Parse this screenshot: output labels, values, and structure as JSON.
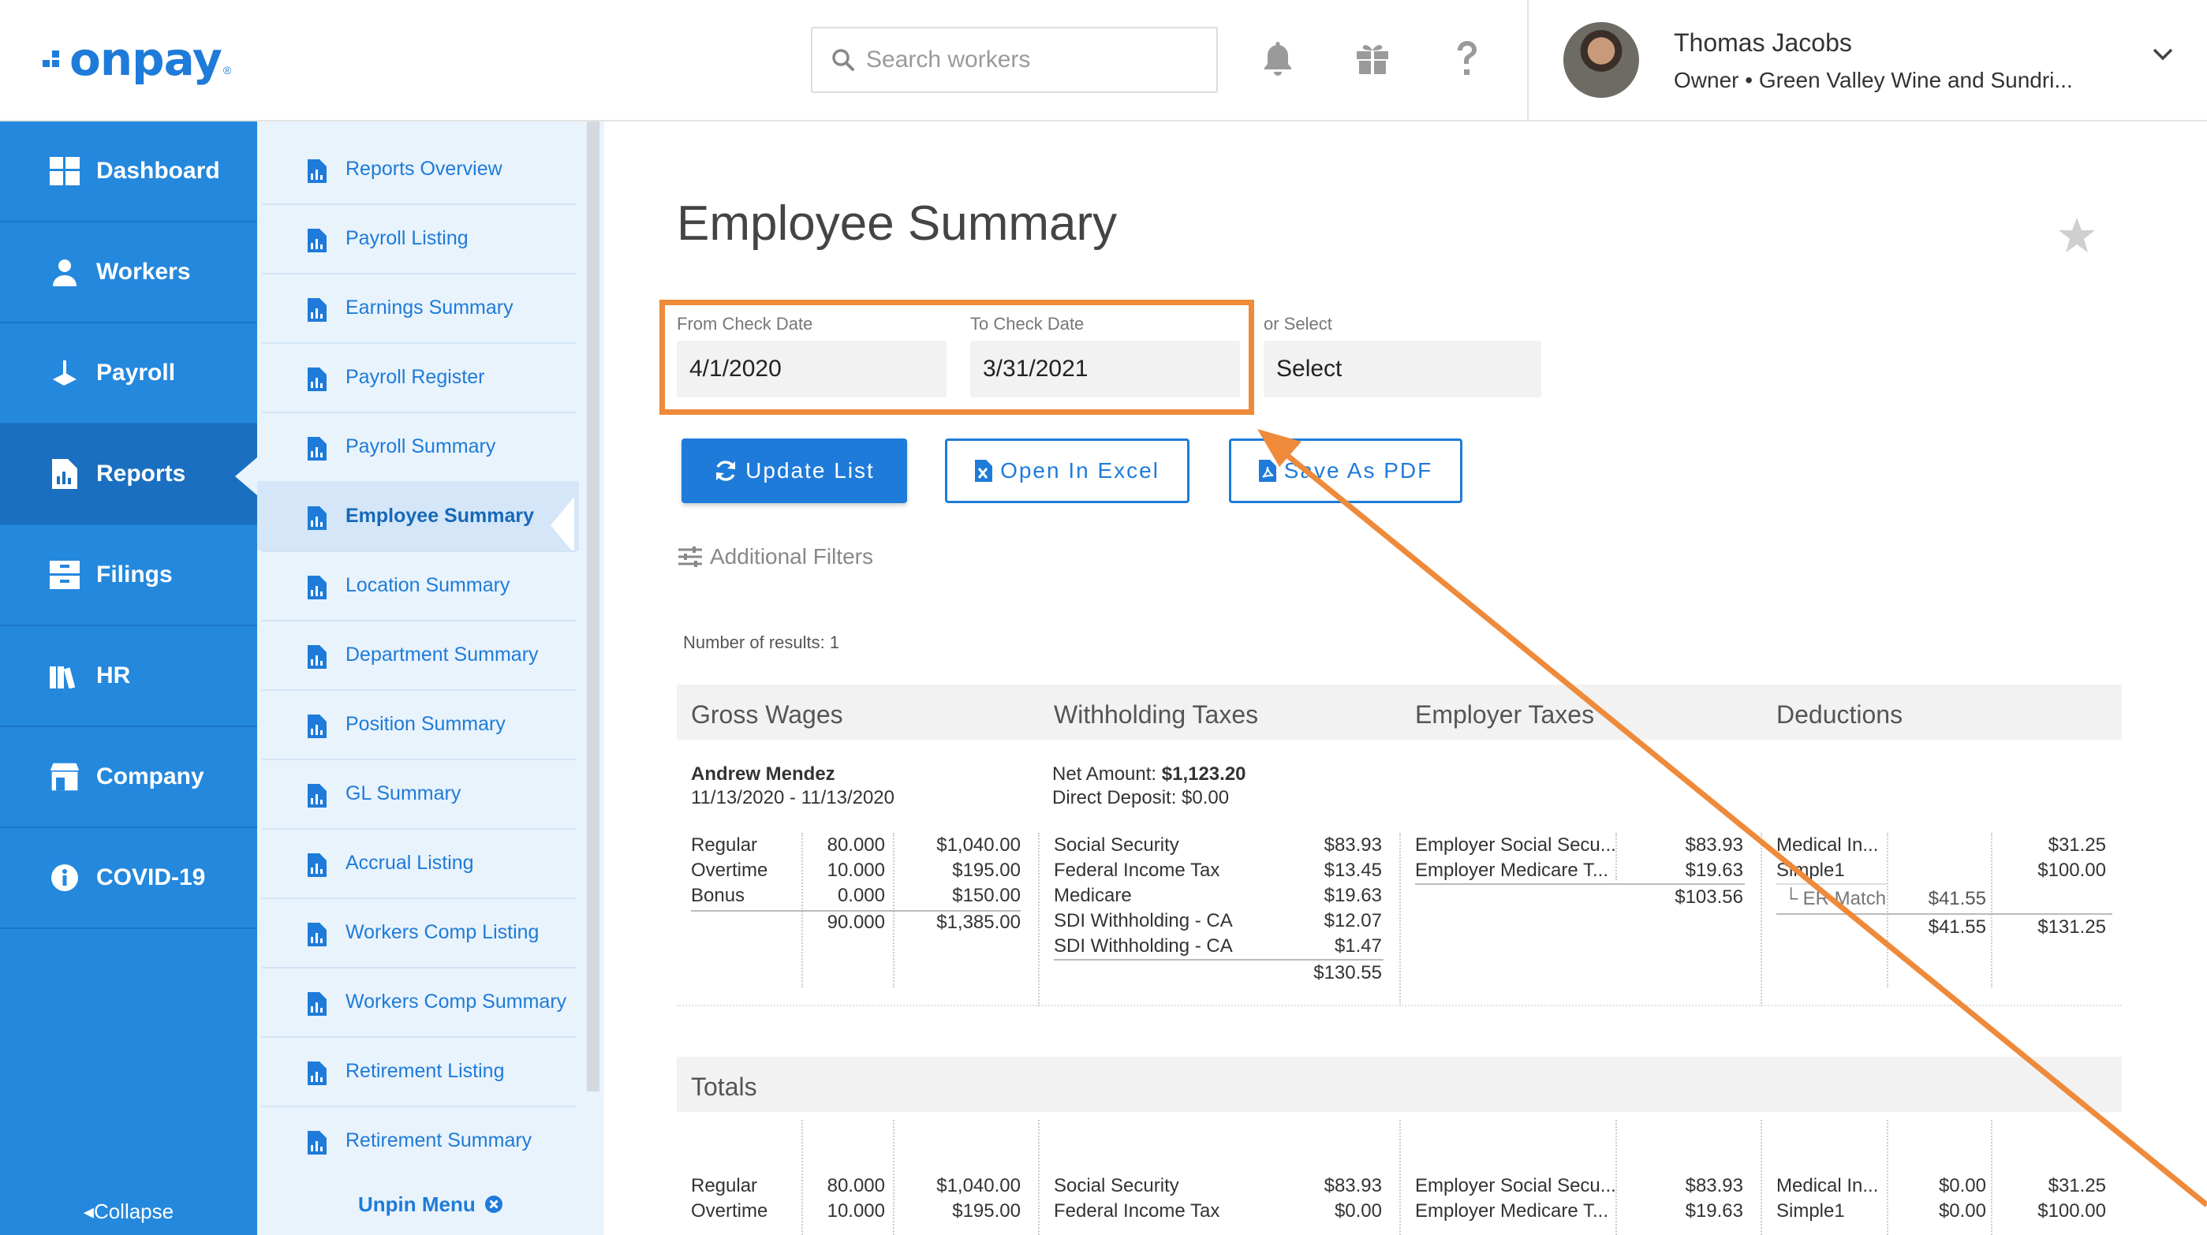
{
  "app": {
    "logo_text": "onpay",
    "logo_reg": "®"
  },
  "header": {
    "search_placeholder": "Search workers",
    "user_name": "Thomas Jacobs",
    "user_role": "Owner • Green Valley Wine and Sundri..."
  },
  "leftnav": {
    "items": [
      {
        "label": "Dashboard",
        "icon": "dashboard-icon"
      },
      {
        "label": "Workers",
        "icon": "workers-icon"
      },
      {
        "label": "Payroll",
        "icon": "payroll-icon"
      },
      {
        "label": "Reports",
        "icon": "reports-icon"
      },
      {
        "label": "Filings",
        "icon": "filings-icon"
      },
      {
        "label": "HR",
        "icon": "hr-icon"
      },
      {
        "label": "Company",
        "icon": "company-icon"
      },
      {
        "label": "COVID-19",
        "icon": "info-icon"
      }
    ],
    "collapse_label": "Collapse"
  },
  "subnav": {
    "items": [
      "Reports Overview",
      "Payroll Listing",
      "Earnings Summary",
      "Payroll Register",
      "Payroll Summary",
      "Employee Summary",
      "Location Summary",
      "Department Summary",
      "Position Summary",
      "GL Summary",
      "Accrual Listing",
      "Workers Comp Listing",
      "Workers Comp Summary",
      "Retirement Listing",
      "Retirement Summary"
    ],
    "unpin_label": "Unpin Menu"
  },
  "main": {
    "title": "Employee Summary",
    "from_label": "From Check Date",
    "from_value": "4/1/2020",
    "to_label": "To Check Date",
    "to_value": "3/31/2021",
    "select_label": "or Select",
    "select_value": "Select",
    "update_button": "Update List",
    "excel_button": "Open In Excel",
    "pdf_button": "Save As PDF",
    "filters_label": "Additional Filters",
    "results_text": "Number of results: 1",
    "columns": [
      "Gross Wages",
      "Withholding Taxes",
      "Employer Taxes",
      "Deductions"
    ],
    "totals_label": "Totals"
  },
  "employee": {
    "name": "Andrew Mendez",
    "period": "11/13/2020  -  11/13/2020",
    "net_label": "Net Amount:",
    "net_value": "$1,123.20",
    "direct_deposit": "Direct Deposit: $0.00",
    "wages": [
      {
        "label": "Regular",
        "hours": "80.000",
        "amount": "$1,040.00"
      },
      {
        "label": "Overtime",
        "hours": "10.000",
        "amount": "$195.00"
      },
      {
        "label": "Bonus",
        "hours": "0.000",
        "amount": "$150.00"
      }
    ],
    "wages_total_hours": "90.000",
    "wages_total_amount": "$1,385.00",
    "withholding": [
      {
        "label": "Social Security",
        "amount": "$83.93"
      },
      {
        "label": "Federal Income Tax",
        "amount": "$13.45"
      },
      {
        "label": "Medicare",
        "amount": "$19.63"
      },
      {
        "label": "SDI Withholding - CA",
        "amount": "$12.07"
      },
      {
        "label": "SDI Withholding - CA",
        "amount": "$1.47"
      }
    ],
    "withholding_total": "$130.55",
    "employer": [
      {
        "label": "Employer Social Secu...",
        "amount": "$83.93"
      },
      {
        "label": "Employer Medicare T...",
        "amount": "$19.63"
      }
    ],
    "employer_total": "$103.56",
    "deductions": [
      {
        "label": "Medical In...",
        "er": "",
        "amount": "$31.25"
      },
      {
        "label": "Simple1",
        "er": "",
        "amount": "$100.00"
      }
    ],
    "er_match_label": "└ ER Match",
    "er_match_value": "$41.55",
    "deductions_total_er": "$41.55",
    "deductions_total": "$131.25"
  },
  "totals": {
    "wages": [
      {
        "label": "Regular",
        "hours": "80.000",
        "amount": "$1,040.00"
      },
      {
        "label": "Overtime",
        "hours": "10.000",
        "amount": "$195.00"
      }
    ],
    "withholding": [
      {
        "label": "Social Security",
        "amount": "$83.93"
      },
      {
        "label": "Federal Income Tax",
        "amount": "$0.00"
      }
    ],
    "employer": [
      {
        "label": "Employer Social Secu...",
        "amount": "$83.93"
      },
      {
        "label": "Employer Medicare T...",
        "amount": "$19.63"
      }
    ],
    "deductions": [
      {
        "label": "Medical In...",
        "er": "$0.00",
        "amount": "$31.25"
      },
      {
        "label": "Simple1",
        "er": "$0.00",
        "amount": "$100.00"
      }
    ]
  },
  "colors": {
    "brand": "#1e7bd9",
    "nav": "#2488dd",
    "annotation": "#ee8a3a"
  }
}
